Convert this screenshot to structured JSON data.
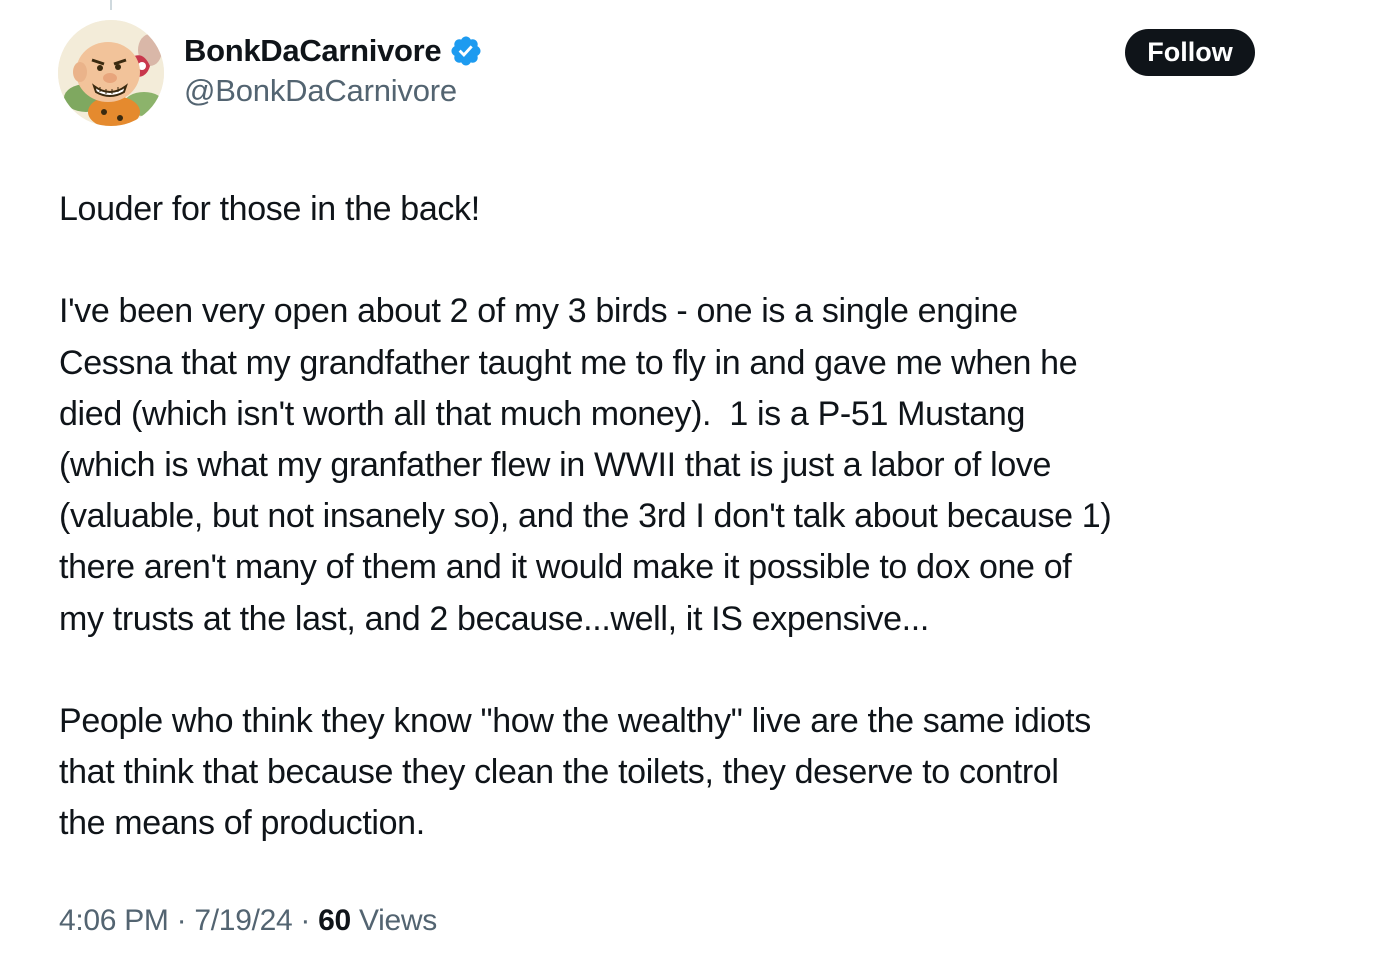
{
  "author": {
    "display_name": "BonkDaCarnivore",
    "handle": "@BonkDaCarnivore",
    "verified": true,
    "verified_color": "#1d9bf0",
    "avatar_icon": "cartoon-caveman-avatar"
  },
  "follow_label": "Follow",
  "tweet": {
    "line1": "Louder for those in the back!",
    "p2_l1": "I've been very open about 2 of my 3 birds - one is a single engine",
    "p2_l2": "Cessna that my grandfather taught me to fly in and gave me when he",
    "p2_l3": "died (which isn't worth all that much money).  1 is a P-51 Mustang",
    "p2_l4": "(which is what my granfather flew in WWII that is just a labor of love",
    "p2_l5": "(valuable, but not insanely so), and the 3rd I don't talk about because 1)",
    "p2_l6": "there aren't many of them and it would make it possible to dox one of",
    "p2_l7": "my trusts at the last, and 2 because...well, it IS expensive...",
    "p3_l1": "People who think they know \"how the wealthy\" live are the same idiots",
    "p3_l2": "that think that because they clean the toilets, they deserve to control",
    "p3_l3": "the means of production."
  },
  "meta": {
    "time": "4:06 PM",
    "separator": " · ",
    "date": "7/19/24",
    "views_count": "60",
    "views_label": " Views"
  }
}
